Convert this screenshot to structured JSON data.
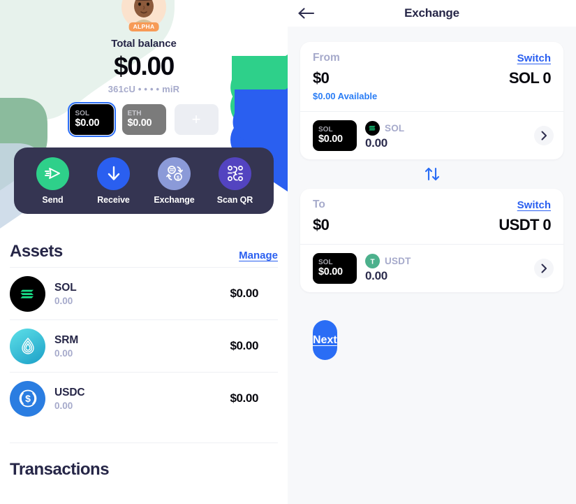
{
  "wallet": {
    "avatar_badge": "ALPHA",
    "total_label": "Total balance",
    "total_amount": "$0.00",
    "address": "361cU • • • • miR",
    "chips": [
      {
        "symbol": "SOL",
        "value": "$0.00",
        "selected": true
      },
      {
        "symbol": "ETH",
        "value": "$0.00",
        "selected": false
      },
      {
        "symbol": "+",
        "value": "",
        "selected": false
      }
    ]
  },
  "actions": [
    {
      "label": "Send",
      "icon": "send-icon"
    },
    {
      "label": "Receive",
      "icon": "download-arrow-icon"
    },
    {
      "label": "Exchange",
      "icon": "exchange-arrows-icon"
    },
    {
      "label": "Scan QR",
      "icon": "qr-code-icon"
    }
  ],
  "assets": {
    "title": "Assets",
    "manage_label": "Manage",
    "rows": [
      {
        "symbol": "SOL",
        "amount": "0.00",
        "value": "$0.00",
        "icon": "solana-icon"
      },
      {
        "symbol": "SRM",
        "amount": "0.00",
        "value": "$0.00",
        "icon": "serum-icon"
      },
      {
        "symbol": "USDC",
        "amount": "0.00",
        "value": "$0.00",
        "icon": "usdc-icon"
      }
    ]
  },
  "transactions": {
    "title": "Transactions"
  },
  "exchange": {
    "title": "Exchange",
    "back_icon": "back-arrow-icon",
    "from": {
      "direction_label": "From",
      "switch_label": "Switch",
      "fiat_amount": "$0",
      "crypto_amount": "SOL 0",
      "available": "$0.00 Available",
      "chip_symbol": "SOL",
      "chip_value": "$0.00",
      "token_name": "SOL",
      "token_amount": "0.00",
      "token_icon": "solana-icon"
    },
    "swap_icon": "swap-vertical-icon",
    "to": {
      "direction_label": "To",
      "switch_label": "Switch",
      "fiat_amount": "$0",
      "crypto_amount": "USDT 0",
      "chip_symbol": "SOL",
      "chip_value": "$0.00",
      "token_name": "USDT",
      "token_amount": "0.00",
      "token_icon": "tether-icon"
    },
    "next_label": "Next"
  },
  "colors": {
    "accent_blue": "#2a6df5",
    "dark_navy": "#353552",
    "green": "#2ed08a",
    "muted": "#a6aacb",
    "orange_badge": "#f79a56",
    "panel_bg": "#f7f8fa"
  }
}
